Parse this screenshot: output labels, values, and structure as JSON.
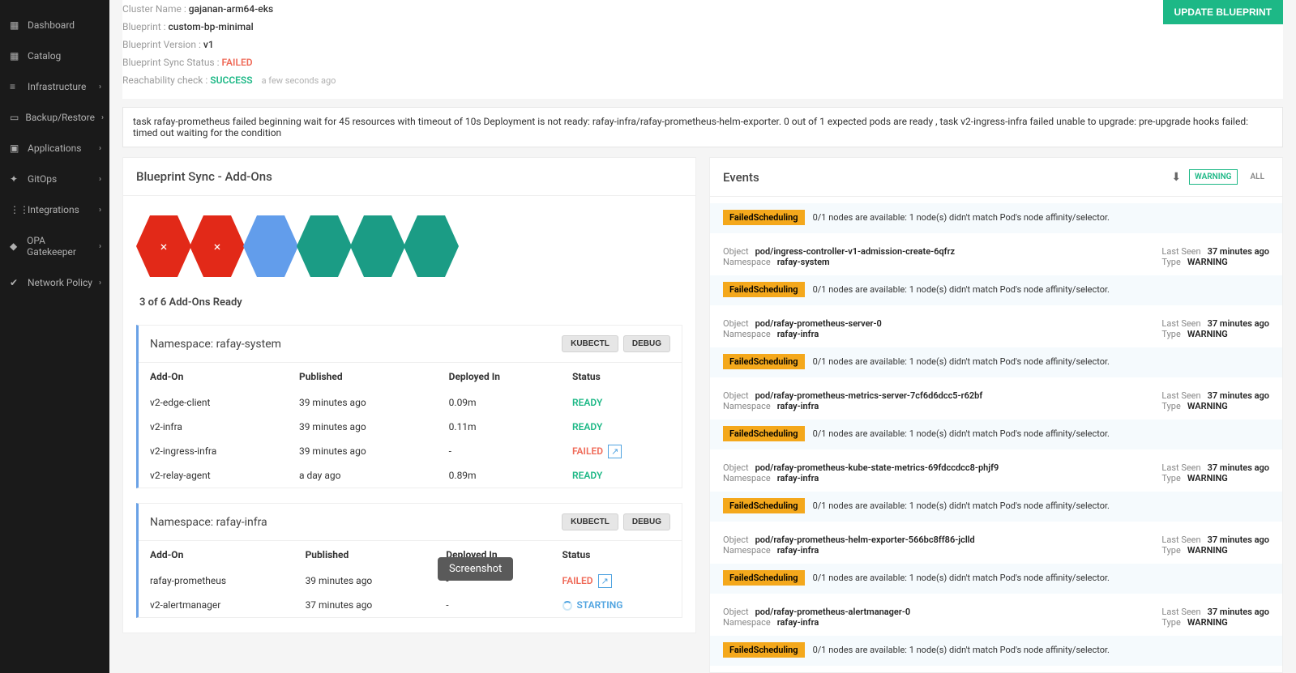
{
  "sidebar": {
    "items": [
      {
        "label": "Dashboard",
        "icon": "▦",
        "chev": ""
      },
      {
        "label": "Catalog",
        "icon": "▦",
        "chev": ""
      },
      {
        "label": "Infrastructure",
        "icon": "≡",
        "chev": "›"
      },
      {
        "label": "Backup/Restore",
        "icon": "▭",
        "chev": "›"
      },
      {
        "label": "Applications",
        "icon": "▣",
        "chev": "›"
      },
      {
        "label": "GitOps",
        "icon": "✦",
        "chev": "›"
      },
      {
        "label": "Integrations",
        "icon": "⋮⋮",
        "chev": "›"
      },
      {
        "label": "OPA Gatekeeper",
        "icon": "◆",
        "chev": "›"
      },
      {
        "label": "Network Policy",
        "icon": "✔",
        "chev": "›"
      }
    ]
  },
  "header": {
    "cluster_label": "Cluster Name :",
    "cluster_name": "gajanan-arm64-eks",
    "blueprint_label": "Blueprint :",
    "blueprint": "custom-bp-minimal",
    "version_label": "Blueprint Version :",
    "version": "v1",
    "sync_label": "Blueprint Sync Status :",
    "sync_status": "FAILED",
    "reach_label": "Reachability check :",
    "reach_status": "SUCCESS",
    "reach_time": "a few seconds ago",
    "update_btn": "UPDATE BLUEPRINT"
  },
  "error_banner": "task rafay-prometheus failed beginning wait for 45 resources with timeout of 10s Deployment is not ready: rafay-infra/rafay-prometheus-helm-exporter. 0 out of 1 expected pods are ready , task v2-ingress-infra failed unable to upgrade: pre-upgrade hooks failed: timed out waiting for the condition",
  "addons": {
    "panel_title": "Blueprint Sync - Add-Ons",
    "hexes": [
      {
        "color": "red",
        "mark": "×"
      },
      {
        "color": "red",
        "mark": "×"
      },
      {
        "color": "blue",
        "mark": ""
      },
      {
        "color": "teal",
        "mark": ""
      },
      {
        "color": "teal",
        "mark": ""
      },
      {
        "color": "teal",
        "mark": ""
      }
    ],
    "summary": "3 of 6 Add-Ons Ready",
    "columns": {
      "addon": "Add-On",
      "published": "Published",
      "deployed": "Deployed In",
      "status": "Status"
    },
    "btn_kubectl": "KUBECTL",
    "btn_debug": "DEBUG",
    "namespaces": [
      {
        "title": "Namespace: rafay-system",
        "rows": [
          {
            "name": "v2-edge-client",
            "published": "39 minutes ago",
            "deployed": "0.09m",
            "status": "READY",
            "status_class": "status-ready"
          },
          {
            "name": "v2-infra",
            "published": "39 minutes ago",
            "deployed": "0.11m",
            "status": "READY",
            "status_class": "status-ready"
          },
          {
            "name": "v2-ingress-infra",
            "published": "39 minutes ago",
            "deployed": "-",
            "status": "FAILED",
            "status_class": "status-failed",
            "ext": true
          },
          {
            "name": "v2-relay-agent",
            "published": "a day ago",
            "deployed": "0.89m",
            "status": "READY",
            "status_class": "status-ready"
          }
        ]
      },
      {
        "title": "Namespace: rafay-infra",
        "rows": [
          {
            "name": "rafay-prometheus",
            "published": "39 minutes ago",
            "deployed": "-",
            "status": "FAILED",
            "status_class": "status-failed",
            "ext": true
          },
          {
            "name": "v2-alertmanager",
            "published": "37 minutes ago",
            "deployed": "-",
            "status": "STARTING",
            "status_class": "status-starting",
            "spinner": true
          }
        ]
      }
    ]
  },
  "events": {
    "title": "Events",
    "filter_warning": "WARNING",
    "filter_all": "ALL",
    "labels": {
      "object": "Object",
      "namespace": "Namespace",
      "last_seen": "Last Seen",
      "type": "Type"
    },
    "common": {
      "badge": "FailedScheduling",
      "msg": "0/1 nodes are available: 1 node(s) didn't match Pod's node affinity/selector.",
      "last_seen": "37 minutes ago",
      "type": "WARNING"
    },
    "items": [
      {
        "object": "pod/ingress-controller-v1-admission-create-6qfrz",
        "namespace": "rafay-system"
      },
      {
        "object": "pod/rafay-prometheus-server-0",
        "namespace": "rafay-infra"
      },
      {
        "object": "pod/rafay-prometheus-metrics-server-7cf6d6dcc5-r62bf",
        "namespace": "rafay-infra"
      },
      {
        "object": "pod/rafay-prometheus-kube-state-metrics-69fdccdcc8-phjf9",
        "namespace": "rafay-infra"
      },
      {
        "object": "pod/rafay-prometheus-helm-exporter-566bc8ff86-jclld",
        "namespace": "rafay-infra"
      },
      {
        "object": "pod/rafay-prometheus-alertmanager-0",
        "namespace": "rafay-infra"
      }
    ]
  },
  "screenshot_pill": "Screenshot"
}
